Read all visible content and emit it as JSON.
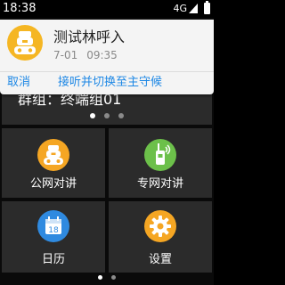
{
  "status_bar": {
    "time": "18:38",
    "network": "4G"
  },
  "group": {
    "label": "群组：终端组01"
  },
  "notification": {
    "title": "测试林呼入",
    "date": "7-01",
    "time": "09:35",
    "cancel_label": "取消",
    "switch_label": "接听并切换至主守候"
  },
  "tiles": [
    {
      "label": "公网对讲",
      "icon": "walkie-talkie-icon",
      "color": "#f5a623"
    },
    {
      "label": "专网对讲",
      "icon": "radio-handset-icon",
      "color": "#6cc04a"
    },
    {
      "label": "日历",
      "icon": "calendar-icon",
      "color": "#2f8ae0",
      "day": "18"
    },
    {
      "label": "设置",
      "icon": "gear-icon",
      "color": "#f5a623"
    }
  ],
  "pager_top": {
    "pages": 3,
    "active": 0
  },
  "pager_bottom": {
    "pages": 2,
    "active": 0
  }
}
